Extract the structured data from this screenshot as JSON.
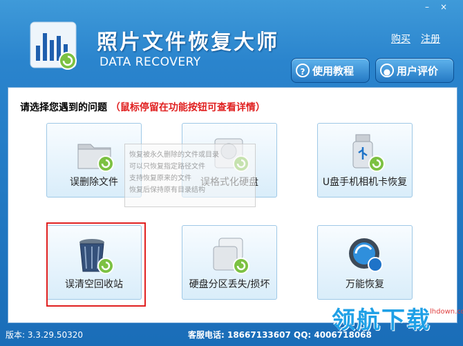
{
  "window": {
    "minimize_glyph": "–",
    "close_glyph": "×"
  },
  "header": {
    "title": "照片文件恢复大师",
    "subtitle": "DATA RECOVERY",
    "links": {
      "buy": "购买",
      "register": "注册"
    },
    "buttons": {
      "tutorial": "使用教程",
      "review": "用户评价"
    }
  },
  "prompt": {
    "question": "请选择您遇到的问题",
    "hint": "（鼠标停留在功能按钮可查看详情）"
  },
  "tiles": [
    {
      "label": "误删除文件",
      "icon": "folder-recover-icon"
    },
    {
      "label": "误格式化硬盘",
      "icon": "hard-disk-recover-icon"
    },
    {
      "label": "U盘手机相机卡恢复",
      "icon": "usb-recover-icon"
    },
    {
      "label": "误清空回收站",
      "icon": "recycle-bin-recover-icon"
    },
    {
      "label": "硬盘分区丢失/损坏",
      "icon": "disk-partition-recover-icon"
    },
    {
      "label": "万能恢复",
      "icon": "universal-recover-icon"
    }
  ],
  "tooltip": {
    "title": "恢复被永久删除的文件或目录",
    "lines": [
      "可以只恢复指定路径文件",
      "支持恢复原来的文件",
      "恢复后保持原有目录结构"
    ]
  },
  "status": {
    "version": "版本: 3.3.29.50320",
    "support": "客服电话: 18667133607  QQ: 4006718068"
  },
  "watermark": {
    "text": "领航下载",
    "url": "lhdown.com"
  },
  "colors": {
    "accent": "#2a84cd",
    "highlight_border": "#e02020",
    "hint_text": "#e02020"
  }
}
